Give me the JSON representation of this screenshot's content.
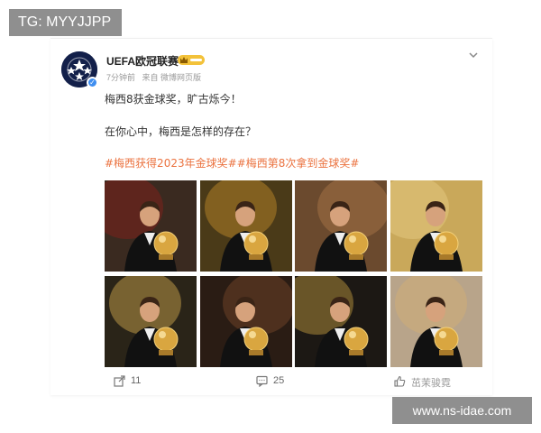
{
  "overlay": {
    "tag": "TG: MYYJJPP",
    "url": "www.ns-idae.com"
  },
  "post": {
    "account_name": "UEFA欧冠联赛",
    "time": "7分钟前",
    "source": "来自 微博网页版",
    "line1": "梅西8获金球奖，旷古烁今！",
    "line2": "在你心中，梅西是怎样的存在？",
    "hashtags": [
      "#梅西获得2023年金球奖#",
      "#梅西第8次拿到金球奖#"
    ],
    "photos": [
      {
        "name": "photo-1",
        "bg": "#3a2a20",
        "accent": "#8b1f1a"
      },
      {
        "name": "photo-2",
        "bg": "#4a3a18",
        "accent": "#c8902a"
      },
      {
        "name": "photo-3",
        "bg": "#6b4a2e",
        "accent": "#b07a4a"
      },
      {
        "name": "photo-4",
        "bg": "#c9a85a",
        "accent": "#e8cf88"
      },
      {
        "name": "photo-5",
        "bg": "#2a2418",
        "accent": "#d8b050"
      },
      {
        "name": "photo-6",
        "bg": "#2a1c14",
        "accent": "#7a4a2a"
      },
      {
        "name": "photo-7",
        "bg": "#1c1814",
        "accent": "#c8a040"
      },
      {
        "name": "photo-8",
        "bg": "#b8a48a",
        "accent": "#d4b070"
      }
    ],
    "actions": {
      "share_count": "11",
      "comment_count": "25"
    },
    "watermark": "茁茉骏霓"
  },
  "colors": {
    "hashtag": "#eb7340",
    "avatar_bg": "#13204a",
    "verified": "#3f8ef0",
    "vip": "#f3c23a"
  },
  "icons": {
    "chevron": "chevron-down-icon",
    "share": "share-icon",
    "comment": "comment-icon",
    "like": "thumbs-up-icon",
    "verified": "verified-icon"
  }
}
